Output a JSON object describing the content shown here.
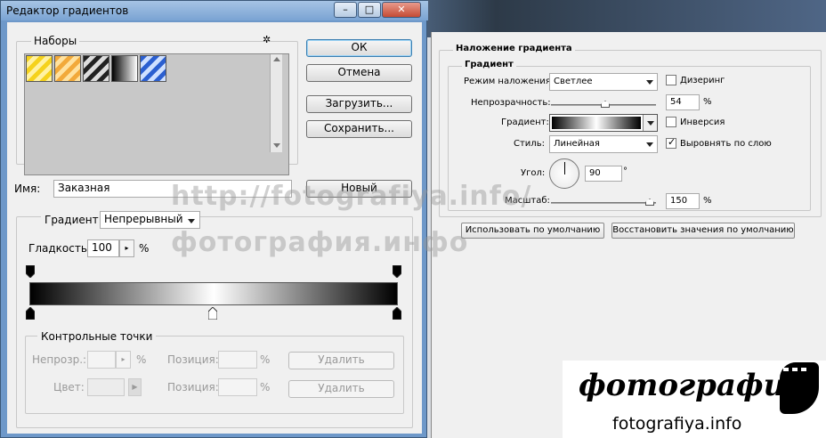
{
  "dialog": {
    "title": "Редактор градиентов",
    "window_buttons": {
      "minimize": "–",
      "maximize": "□",
      "close": "✕"
    },
    "presets_label": "Наборы",
    "gear_glyph": "✲",
    "swatches": [
      {
        "name": "yellow-stripes",
        "colors": [
          "#f5d21c",
          "#fff2a3"
        ]
      },
      {
        "name": "orange-stripes",
        "colors": [
          "#f2a93a",
          "#ffe2a0"
        ]
      },
      {
        "name": "black-silver-stripes",
        "colors": [
          "#222222",
          "#dddddd"
        ]
      },
      {
        "name": "black-white",
        "colors": [
          "#000000",
          "#ffffff"
        ]
      },
      {
        "name": "blue-stripes",
        "colors": [
          "#2b5fd0",
          "#cfe0ff"
        ]
      }
    ],
    "buttons": {
      "ok": "ОК",
      "cancel": "Отмена",
      "load": "Загрузить...",
      "save": "Сохранить...",
      "new": "Новый"
    },
    "name_label": "Имя:",
    "name_value": "Заказная",
    "gradient_type_label": "Градиент:",
    "gradient_type_value": "Непрерывный",
    "smoothness_label": "Гладкость:",
    "smoothness_value": "100",
    "smoothness_unit": "%",
    "gradient_colors": [
      "#000000",
      "#ffffff",
      "#000000"
    ],
    "stops_group": {
      "title": "Контрольные точки",
      "opacity_label": "Непрозр.:",
      "opacity_unit": "%",
      "position_label": "Позиция:",
      "position_unit": "%",
      "delete_label": "Удалить",
      "color_label": "Цвет:"
    }
  },
  "layer_style": {
    "section_title": "Наложение градиента",
    "group_title": "Градиент",
    "blend_mode_label": "Режим наложения:",
    "blend_mode_value": "Светлее",
    "dither_label": "Дизеринг",
    "dither_checked": false,
    "opacity_label": "Непрозрачность:",
    "opacity_value": "54",
    "opacity_unit": "%",
    "gradient_label": "Градиент:",
    "reverse_label": "Инверсия",
    "reverse_checked": false,
    "style_label": "Стиль:",
    "style_value": "Линейная",
    "align_label": "Выровнять по слою",
    "align_checked": true,
    "angle_label": "Угол:",
    "angle_value": "90",
    "angle_unit": "°",
    "scale_label": "Масштаб:",
    "scale_value": "150",
    "scale_unit": "%",
    "make_default_label": "Использовать по умолчанию",
    "reset_default_label": "Восстановить значения по умолчанию"
  },
  "watermark": {
    "line1": "http://fotografiya.info/",
    "line2": "фотография.инфо"
  },
  "logo": {
    "text": "фотография",
    "url": "fotografiya.info"
  }
}
